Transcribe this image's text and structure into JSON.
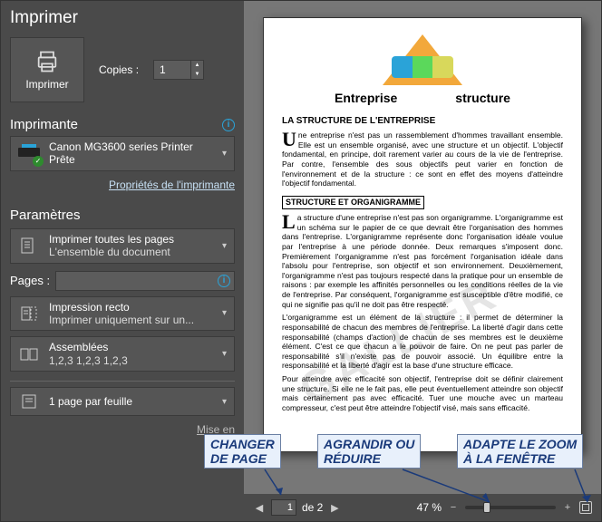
{
  "title": "Imprimer",
  "print": {
    "button": "Imprimer",
    "copies_label": "Copies :",
    "copies_value": "1"
  },
  "printer_section": {
    "title": "Imprimante",
    "name": "Canon MG3600 series Printer",
    "status": "Prête",
    "properties_link": "Propriétés de l'imprimante"
  },
  "settings": {
    "title": "Paramètres",
    "print_all": {
      "line1": "Imprimer toutes les pages",
      "line2": "L'ensemble du document"
    },
    "pages_label": "Pages :",
    "recto": {
      "line1": "Impression recto",
      "line2": "Imprimer uniquement sur un..."
    },
    "collate": {
      "line1": "Assemblées",
      "line2": "1,2,3   1,2,3   1,2,3"
    },
    "sheets": {
      "line1": "1 page par feuille"
    },
    "mise_en_page": "Mise en"
  },
  "toolbar": {
    "page_current": "1",
    "page_of": "de 2",
    "zoom_label": "47 %",
    "minus": "−",
    "plus": "+"
  },
  "callouts": {
    "change_page": "CHANGER\nDE PAGE",
    "agrandir": "AGRANDIR OU\nRÉDUIRE",
    "adapte": "ADAPTE LE ZOOM\nÀ LA FENÊTRE"
  },
  "doc": {
    "heading_left": "Entreprise",
    "heading_right": "structure",
    "h3": "LA STRUCTURE DE L'ENTREPRISE",
    "p1_drop": "U",
    "p1": "ne entreprise n'est pas un rassemblement d'hommes travaillant ensemble. Elle est un ensemble organisé, avec une structure et un objectif. L'objectif fondamental, en principe, doit rarement varier au cours de la vie de l'entreprise. Par contre, l'ensemble des sous objectifs peut varier en fonction de l'environnement et de la structure : ce sont en effet des moyens d'atteindre l'objectif fondamental.",
    "box": "STRUCTURE ET ORGANIGRAMME",
    "p2_drop": "L",
    "p2": "a structure d'une entreprise n'est pas son organigramme. L'organigramme est un schéma sur le papier de ce que devrait être l'organisation des hommes dans l'entreprise. L'organigramme représente donc l'organisation idéale voulue par l'entreprise à une période donnée. Deux remarques s'imposent donc. Premièrement l'organigramme n'est pas forcément l'organisation idéale dans l'absolu pour l'entreprise, son objectif et son environnement. Deuxièmement, l'organigramme n'est pas toujours respecté dans la pratique pour un ensemble de raisons : par exemple les affinités personnelles ou les conditions réelles de la vie de l'entreprise. Par conséquent, l'organigramme est susceptible d'être modifié, ce qui ne signifie pas qu'il ne doit pas être respecté.",
    "p3": "L'organigramme est un élément de la structure : il permet de déterminer la responsabilité de chacun des membres de l'entreprise. La liberté d'agir dans cette responsabilité (champs d'action) de chacun de ses membres est le deuxième élément. C'est ce que chacun a le pouvoir de faire. On ne peut pas parler de responsabilité s'il n'existe pas de pouvoir associé. Un équilibre entre la responsabilité et la liberté d'agir est la base d'une structure efficace.",
    "p4": "Pour atteindre avec efficacité son objectif, l'entreprise doit se définir clairement une structure. Si elle ne le fait pas, elle peut éventuellement atteindre son objectif mais certainement pas avec efficacité. Tuer une mouche avec un marteau compresseur, c'est peut être atteindre l'objectif visé, mais sans efficacité.",
    "watermark": "GALLIER"
  }
}
